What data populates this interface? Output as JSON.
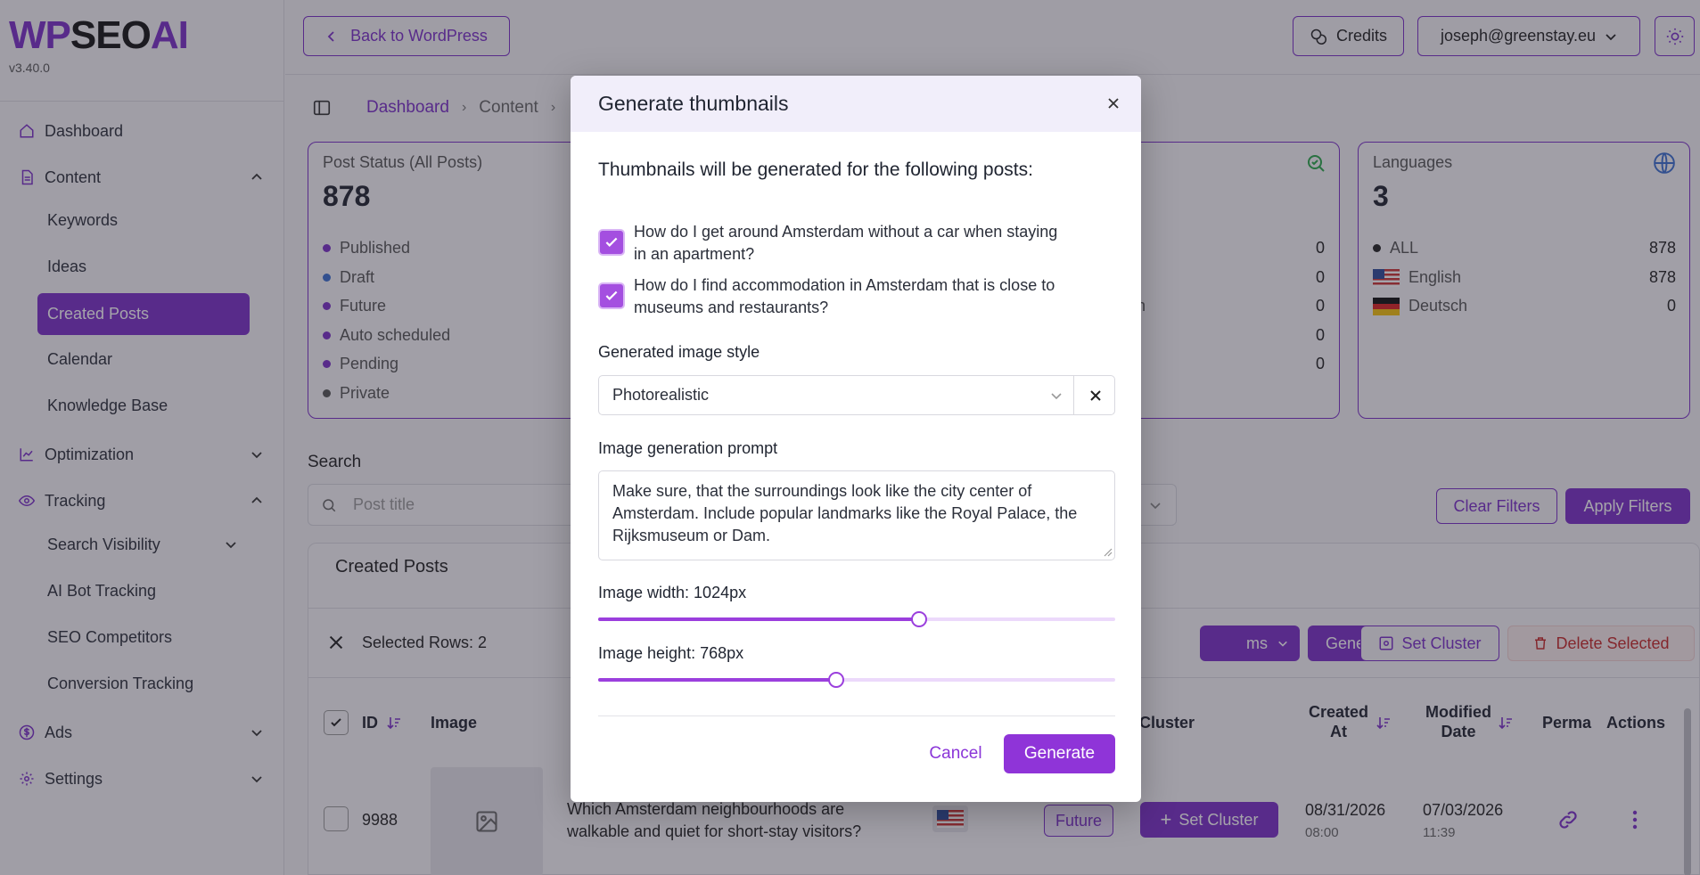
{
  "app": {
    "logo_wp": "WP",
    "logo_seo": "SEO",
    "logo_ai": "AI",
    "version": "v3.40.0"
  },
  "sidebar": {
    "dashboard": "Dashboard",
    "content": "Content",
    "keywords": "Keywords",
    "ideas": "Ideas",
    "created_posts": "Created Posts",
    "calendar": "Calendar",
    "knowledge_base": "Knowledge Base",
    "optimization": "Optimization",
    "tracking": "Tracking",
    "search_visibility": "Search Visibility",
    "ai_bot_tracking": "AI Bot Tracking",
    "seo_competitors": "SEO Competitors",
    "conversion_tracking": "Conversion Tracking",
    "ads": "Ads",
    "settings": "Settings"
  },
  "topbar": {
    "back": "Back to WordPress",
    "credits": "Credits",
    "account": "joseph@greenstay.eu"
  },
  "breadcrumb": {
    "home": "Dashboard",
    "content": "Content"
  },
  "post_status_card": {
    "title": "Post Status (All Posts)",
    "total": "878",
    "rows": [
      {
        "label": "Published",
        "color": "#7b2fc9"
      },
      {
        "label": "Draft",
        "color": "#3b6fd1"
      },
      {
        "label": "Future",
        "color": "#7b2fc9"
      },
      {
        "label": "Auto scheduled",
        "color": "#7b2fc9"
      },
      {
        "label": "Pending",
        "color": "#7b2fc9"
      },
      {
        "label": "Private",
        "color": "#555555"
      }
    ]
  },
  "middle_card": {
    "partial_label": "ntion",
    "values": [
      "0",
      "0",
      "0",
      "0",
      "0"
    ]
  },
  "languages_card": {
    "title": "Languages",
    "total": "3",
    "rows": [
      {
        "label": "ALL",
        "value": "878"
      },
      {
        "label": "English",
        "value": "878"
      },
      {
        "label": "Deutsch",
        "value": "0"
      }
    ]
  },
  "search": {
    "label": "Search",
    "placeholder": "Post title"
  },
  "filters": {
    "clear": "Clear Filters",
    "apply": "Apply Filters"
  },
  "table": {
    "title": "Created Posts",
    "selected": "Selected Rows: 2",
    "actions": {
      "items_partial": "ms",
      "faq": "Generate FAQ",
      "cluster": "Set Cluster",
      "delete": "Delete Selected"
    },
    "headers": {
      "id": "ID",
      "image": "Image",
      "cluster": "Cluster",
      "created_1": "Created",
      "created_2": "At",
      "modified_1": "Modified",
      "modified_2": "Date",
      "perma": "Perma",
      "actions": "Actions"
    },
    "row": {
      "id": "9988",
      "title_line1": "Which Amsterdam neighbourhoods are",
      "title_line2": "walkable and quiet for short-stay visitors?",
      "status": "Future",
      "set_cluster": "Set Cluster",
      "created_date": "08/31/2026",
      "created_time": "08:00",
      "modified_date": "07/03/2026",
      "modified_time": "11:39"
    }
  },
  "modal": {
    "title": "Generate thumbnails",
    "intro": "Thumbnails will be generated for the following posts:",
    "posts": [
      {
        "line1": "How do I get around Amsterdam without a car when staying",
        "line2": "in an apartment?",
        "checked": true
      },
      {
        "line1": "How do I find accommodation in Amsterdam that is close to",
        "line2": "museums and restaurants?",
        "checked": true
      }
    ],
    "style_label": "Generated image style",
    "style_value": "Photorealistic",
    "prompt_label": "Image generation prompt",
    "prompt_value": "Make sure, that the surroundings look like the city center of Amsterdam. Include popular landmarks like the Royal Palace, the Rijksmuseum or Dam.",
    "width_label": "Image width: 1024px",
    "width_fraction": 0.62,
    "height_label": "Image height: 768px",
    "height_fraction": 0.46,
    "cancel": "Cancel",
    "generate": "Generate"
  },
  "colors": {
    "accent": "#7b2fc9",
    "button": "#8f34d8",
    "overlay": "rgba(40,38,52,0.42)"
  }
}
